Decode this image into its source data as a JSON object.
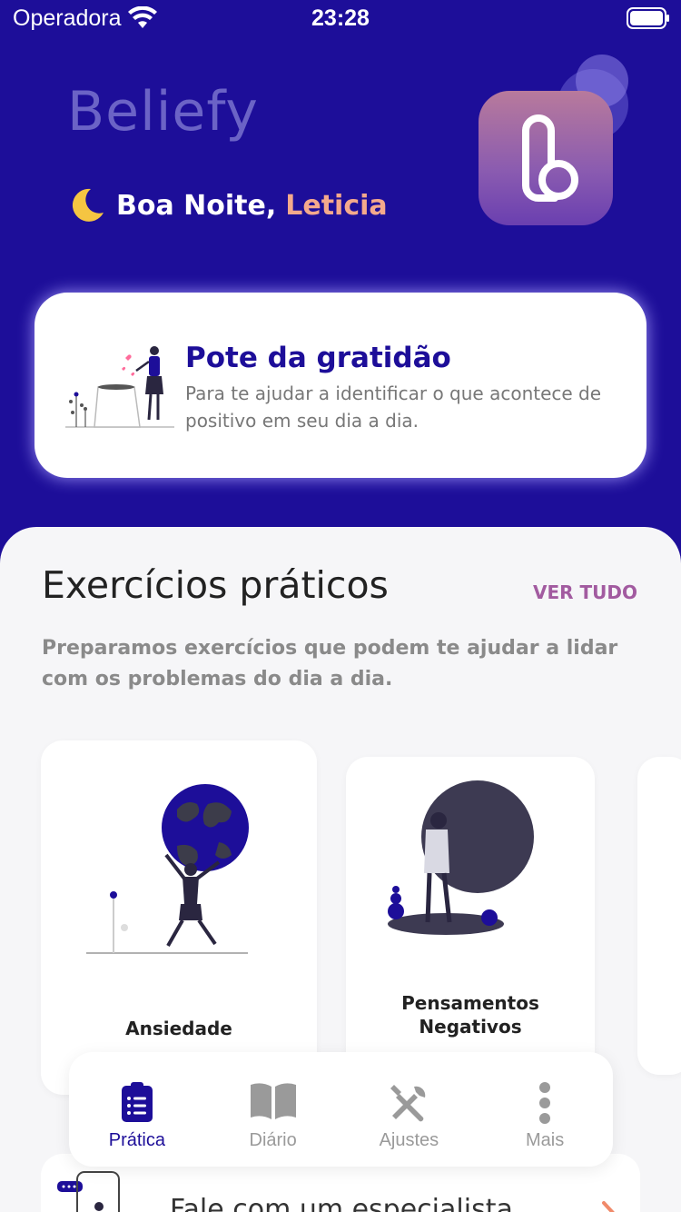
{
  "status_bar": {
    "carrier": "Operadora",
    "time": "23:28"
  },
  "header": {
    "logo_text": "Beliefy",
    "greeting_prefix": "Boa Noite,",
    "greeting_name": "Leticia"
  },
  "gratitude_card": {
    "title": "Pote da gratidão",
    "description": "Para te ajudar a identificar o que acontece de positivo em seu dia a dia."
  },
  "exercises": {
    "title": "Exercícios práticos",
    "see_all": "VER TUDO",
    "description": "Preparamos exercícios que podem te ajudar a lidar com os problemas do dia a dia.",
    "cards": [
      {
        "label": "Ansiedade"
      },
      {
        "label_line1": "Pensamentos",
        "label_line2": "Negativos"
      }
    ]
  },
  "specialist": {
    "label": "Fale com um especialista"
  },
  "tabbar": {
    "tabs": [
      {
        "label": "Prática",
        "icon": "clipboard-list-icon",
        "active": true
      },
      {
        "label": "Diário",
        "icon": "book-icon",
        "active": false
      },
      {
        "label": "Ajustes",
        "icon": "tools-icon",
        "active": false
      },
      {
        "label": "Mais",
        "icon": "more-vertical-icon",
        "active": false
      }
    ]
  },
  "colors": {
    "primary": "#1d0e99",
    "accent_name": "#f4a98c",
    "link": "#a25ba0",
    "sheet_bg": "#f6f6f8"
  }
}
